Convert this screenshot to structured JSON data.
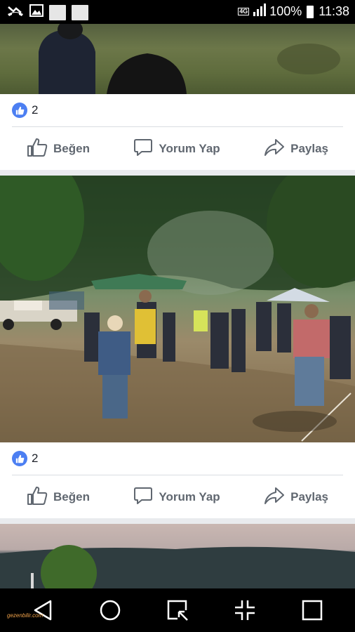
{
  "status_bar": {
    "network": "4G",
    "battery": "100%",
    "time": "11:38",
    "icons": [
      "missed-call-icon",
      "gallery-icon",
      "notification-icon",
      "notification-icon",
      "network-4g-icon",
      "signal-icon",
      "battery-icon"
    ]
  },
  "posts": [
    {
      "photo_desc_icon": "photo",
      "reaction_count": "2",
      "actions": {
        "like": "Beğen",
        "comment": "Yorum Yap",
        "share": "Paylaş"
      }
    },
    {
      "photo_desc_icon": "photo",
      "reaction_count": "2",
      "actions": {
        "like": "Beğen",
        "comment": "Yorum Yap",
        "share": "Paylaş"
      }
    }
  ],
  "nav_bar": {
    "buttons": [
      "back-icon",
      "home-icon",
      "capture-icon",
      "fullscreen-icon",
      "recents-icon"
    ],
    "watermark": "gezenbilir.com"
  },
  "colors": {
    "like_blue": "#4c7ff2",
    "action_grey": "#606770"
  }
}
